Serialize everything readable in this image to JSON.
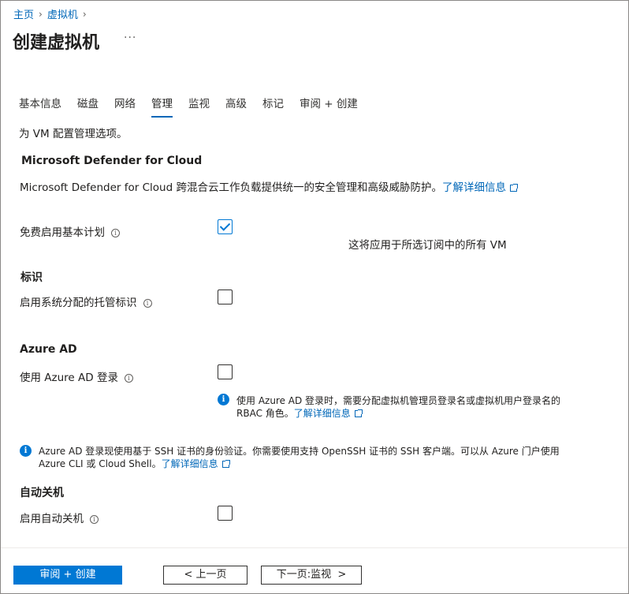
{
  "breadcrumb": [
    {
      "label": "主页"
    },
    {
      "label": "虚拟机"
    }
  ],
  "header": {
    "title": "创建虚拟机",
    "more": "···"
  },
  "tabs": [
    {
      "label": "基本信息",
      "active": false
    },
    {
      "label": "磁盘",
      "active": false
    },
    {
      "label": "网络",
      "active": false
    },
    {
      "label": "管理",
      "active": true
    },
    {
      "label": "监视",
      "active": false
    },
    {
      "label": "高级",
      "active": false
    },
    {
      "label": "标记",
      "active": false
    },
    {
      "label": "审阅 + 创建",
      "active": false
    }
  ],
  "intro": "为 VM 配置管理选项。",
  "defender": {
    "heading": "Microsoft Defender for Cloud",
    "text": "Microsoft Defender for Cloud 跨混合云工作负载提供统一的安全管理和高级威胁防护。",
    "link": "了解详细信息",
    "basic_plan_label": "免费启用基本计划",
    "basic_plan_checked": true,
    "basic_plan_note": "这将应用于所选订阅中的所有 VM"
  },
  "identity": {
    "heading": "标识",
    "msi_label": "启用系统分配的托管标识",
    "msi_checked": false
  },
  "azure_ad": {
    "heading": "Azure AD",
    "login_label": "使用 Azure AD 登录",
    "login_checked": false,
    "info_line1": "使用 Azure AD 登录时，需要分配虚拟机管理员登录名或虚拟机用户登录名的",
    "info_line2": "RBAC 角色。",
    "info_link": "了解详细信息"
  },
  "ssh_notice": {
    "line1": "Azure AD 登录现使用基于 SSH 证书的身份验证。你需要使用支持 OpenSSH 证书的 SSH 客户端。可以从 Azure 门户使用",
    "line2": "Azure CLI 或 Cloud Shell。",
    "link": "了解详细信息"
  },
  "auto_shutdown": {
    "heading": "自动关机",
    "label": "启用自动关机",
    "checked": false
  },
  "footer": {
    "review_create": "审阅 + 创建",
    "prev": "< 上一页",
    "next": "下一页:监视  >"
  },
  "colors": {
    "accent": "#0078d4",
    "link": "#0067b8"
  }
}
